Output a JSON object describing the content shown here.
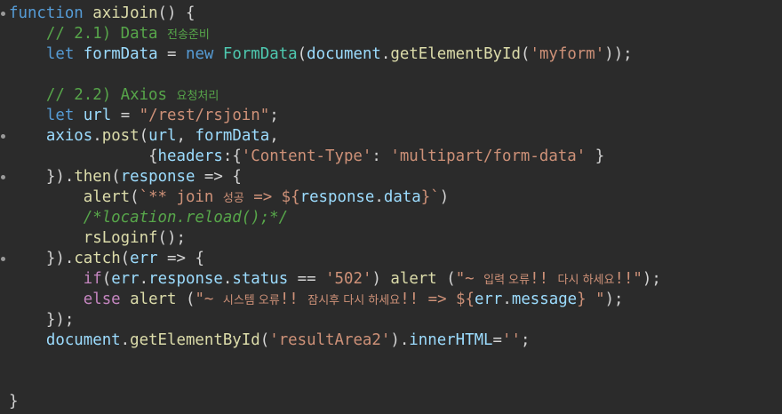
{
  "code": {
    "l1": [
      "function",
      " ",
      "axiJoin",
      "() {"
    ],
    "l2": [
      "// 2.1) Data ",
      "전송준비"
    ],
    "l3": [
      "let",
      " ",
      "formData",
      " = ",
      "new",
      " ",
      "FormData",
      "(",
      "document",
      ".",
      "getElementById",
      "(",
      "'myform'",
      "));"
    ],
    "l5": [
      "// 2.2) Axios ",
      "요청처리"
    ],
    "l6": [
      "let",
      " ",
      "url",
      " = ",
      "\"/rest/rsjoin\"",
      ";"
    ],
    "l7": [
      "axios",
      ".",
      "post",
      "(",
      "url",
      ", ",
      "formData",
      ","
    ],
    "l8": [
      "{",
      "headers",
      ":{",
      "'Content-Type'",
      ": ",
      "'multipart/form-data'",
      " }"
    ],
    "l9": [
      "}).",
      "then",
      "(",
      "response",
      " => {"
    ],
    "l10": [
      "alert",
      "(",
      "`** join ",
      "성공",
      " => ${",
      "response",
      ".",
      "data",
      "}`",
      ")"
    ],
    "l11": [
      "/*location.reload();*/"
    ],
    "l12": [
      "rsLoginf",
      "();"
    ],
    "l13": [
      "}).",
      "catch",
      "(",
      "err",
      " => {"
    ],
    "l14": [
      "if",
      "(",
      "err",
      ".",
      "response",
      ".",
      "status",
      " == ",
      "'502'",
      ") ",
      "alert",
      " (",
      "\"~ ",
      "입력 오류",
      "!! ",
      "다시 하세요",
      "!!\"",
      ");"
    ],
    "l15": [
      "else",
      " ",
      "alert",
      " (",
      "\"~ ",
      "시스템 오류",
      "!! ",
      "잠시후 다시 하세요",
      "!! => ${",
      "err",
      ".",
      "message",
      "} \"",
      ");"
    ],
    "l16": [
      "});"
    ],
    "l17": [
      "document",
      ".",
      "getElementById",
      "(",
      "'resultArea2'",
      ").",
      "innerHTML",
      "=",
      "''",
      ";"
    ],
    "l20": [
      "}"
    ]
  }
}
